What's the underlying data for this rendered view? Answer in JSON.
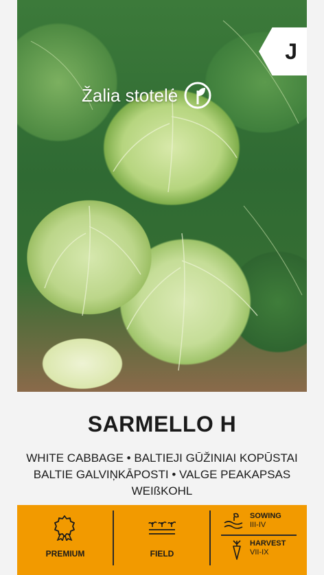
{
  "brand": {
    "name": "Žalia stotelė"
  },
  "badge": {
    "letter": "J"
  },
  "product": {
    "title": "SARMELLO H",
    "subtitle_lines": [
      "WHITE CABBAGE • BALTIEJI GŪŽINIAI KOPŪSTAI",
      "BALTIE GALVIŅKĀPOSTI • VALGE PEAKAPSAS",
      "WEIßKOHL"
    ]
  },
  "info": {
    "premium_label": "PREMIUM",
    "field_label": "FIELD",
    "sowing_label": "SOWING",
    "sowing_period": "III-IV",
    "harvest_label": "HARVEST",
    "harvest_period": "VII-IX"
  },
  "colors": {
    "accent": "#f29a00",
    "text": "#1a1a1a",
    "background": "#f3f3f3"
  },
  "icons": [
    "leaf-logo-icon",
    "premium-rosette-icon",
    "field-sprout-icon",
    "sowing-seed-icon",
    "harvest-carrot-icon"
  ]
}
